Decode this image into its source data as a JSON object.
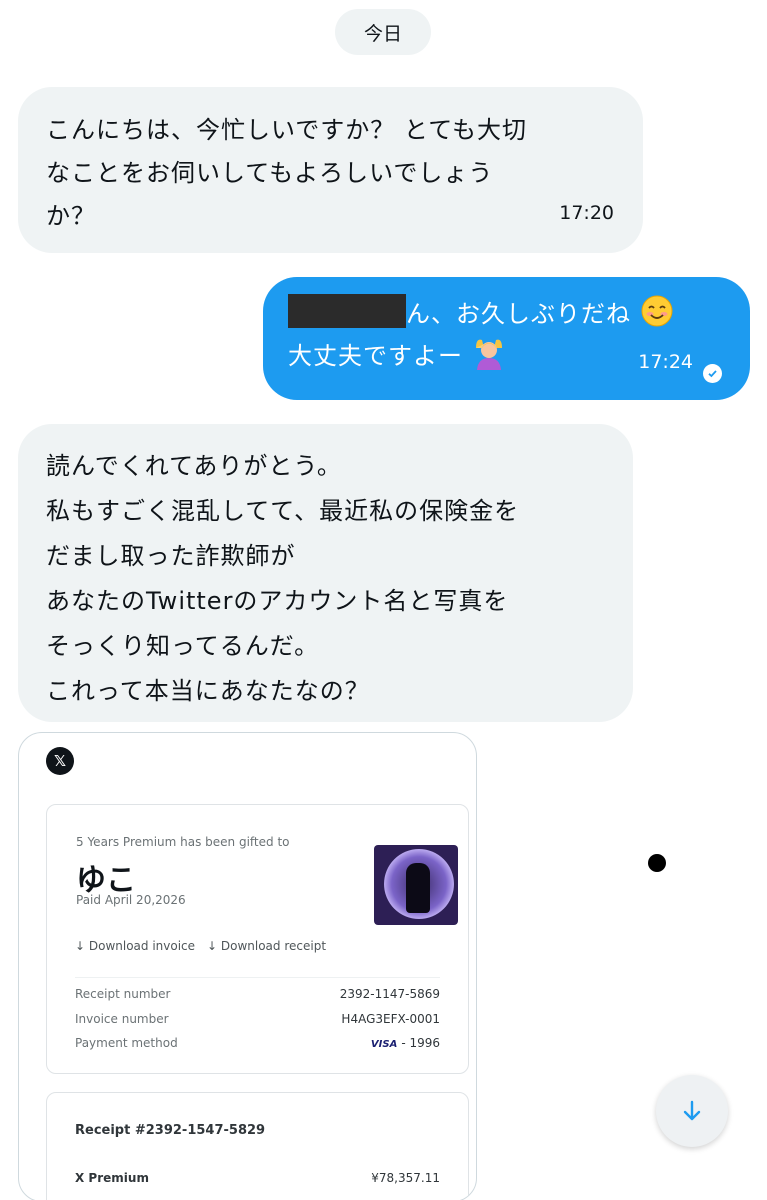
{
  "date_label": "今日",
  "messages": [
    {
      "lines": [
        "こんにちは、今忙しいですか？ とても大切",
        "なことをお伺いしてもよろしいでしょう",
        "か？"
      ],
      "time": "17:20"
    },
    {
      "lines_prefix": "ん、お久しぶりだね",
      "line2": "大丈夫ですよー",
      "time": "17:24"
    },
    {
      "lines": [
        "読んでくれてありがとう。",
        "私もすごく混乱してて、最近私の保険金を",
        "だまし取った詐欺師が",
        "あなたのTwitterのアカウント名と写真を",
        "そっくり知ってるんだ。",
        "これって本当にあなたなの？"
      ]
    }
  ],
  "receipt": {
    "gift_text": "5 Years Premium has been gifted to",
    "recipient": "ゆこ",
    "paid_text": "Paid April 20,2026",
    "download_invoice": "↓  Download invoice",
    "download_receipt": "↓  Download receipt",
    "rows": [
      {
        "label": "Receipt number",
        "value": "2392-1147-5869"
      },
      {
        "label": "Invoice number",
        "value": "H4AG3EFX-0001"
      },
      {
        "label": "Payment method",
        "value": "- 1996",
        "brand": "VISA"
      }
    ],
    "receipt_title": "Receipt #2392-1547-5829",
    "item_label": "X Premium",
    "item_value": "¥78,357.11"
  },
  "colors": {
    "outgoing": "#1d9bf0",
    "incoming": "#eff3f4"
  }
}
